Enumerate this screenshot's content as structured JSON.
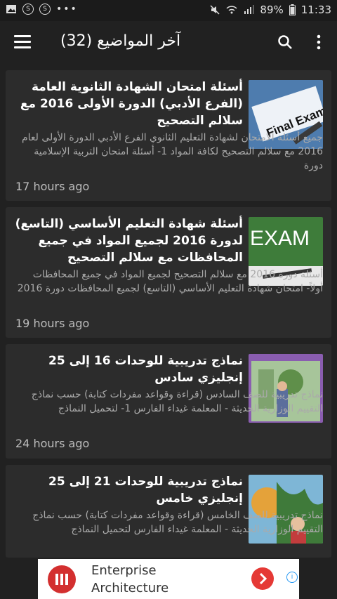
{
  "status": {
    "battery": "89%",
    "time": "11:33",
    "indicators": [
      "image-icon",
      "s-icon",
      "s-icon",
      "more-dots"
    ]
  },
  "appbar": {
    "title": "آخر المواضيع (32)"
  },
  "posts": [
    {
      "title": "أسئلة امتحان الشهادة الثانوية العامة (الفرع الأدبي) الدورة الأولى 2016 مع سلالم التصحيح",
      "snippet": "جميع أسئلة الامتحان لشهادة التعليم الثانوي الفرع الأدبي الدورة الأولى لعام 2016 مع سلالم التصحيح لكافة المواد 1- أسئلة امتحان التربية الإسلامية دورة",
      "time": "17 hours ago",
      "thumb": "final-exam"
    },
    {
      "title": "أسئلة شهادة التعليم الأساسي (التاسع) لدورة 2016 لجميع المواد في جميع المحافظات مع سلالم التصحيح",
      "snippet": "أسئلة دورة 2016 مع سلالم التصحيح لجميع المواد في جميع المحافظات أولاً- امتحان شهادة التعليم الأساسي (التاسع) لجميع المحافظات دورة 2016",
      "time": "19 hours ago",
      "thumb": "exam-board"
    },
    {
      "title": "نماذج تدريبية للوحدات 16 إلى 25 إنجليزي سادس",
      "snippet": "نماذج تدريبية للصف السادس (قراءة وقواعد مفردات كتابة) حسب نماذج التقييم الوزارية الحديثة - المعلمة غيداء الفارس 1- لتحميل النماذج",
      "time": "24 hours ago",
      "thumb": "book-cover-six"
    },
    {
      "title": "نماذج تدريبية للوحدات 21 إلى 25 إنجليزي خامس",
      "snippet": "نماذج تدريبية للصف الخامس (قراءة وقواعد مفردات كتابة) حسب نماذج التقييم الوزارية الحديثة - المعلمة غيداء الفارس لتحميل النماذج",
      "time": "",
      "thumb": "book-cover-five"
    }
  ],
  "ad": {
    "line1": "Enterprise",
    "line2": "Architecture",
    "info": "i"
  },
  "thumb_text": {
    "final_exam": "Final Exam",
    "exam": "EXAM"
  }
}
